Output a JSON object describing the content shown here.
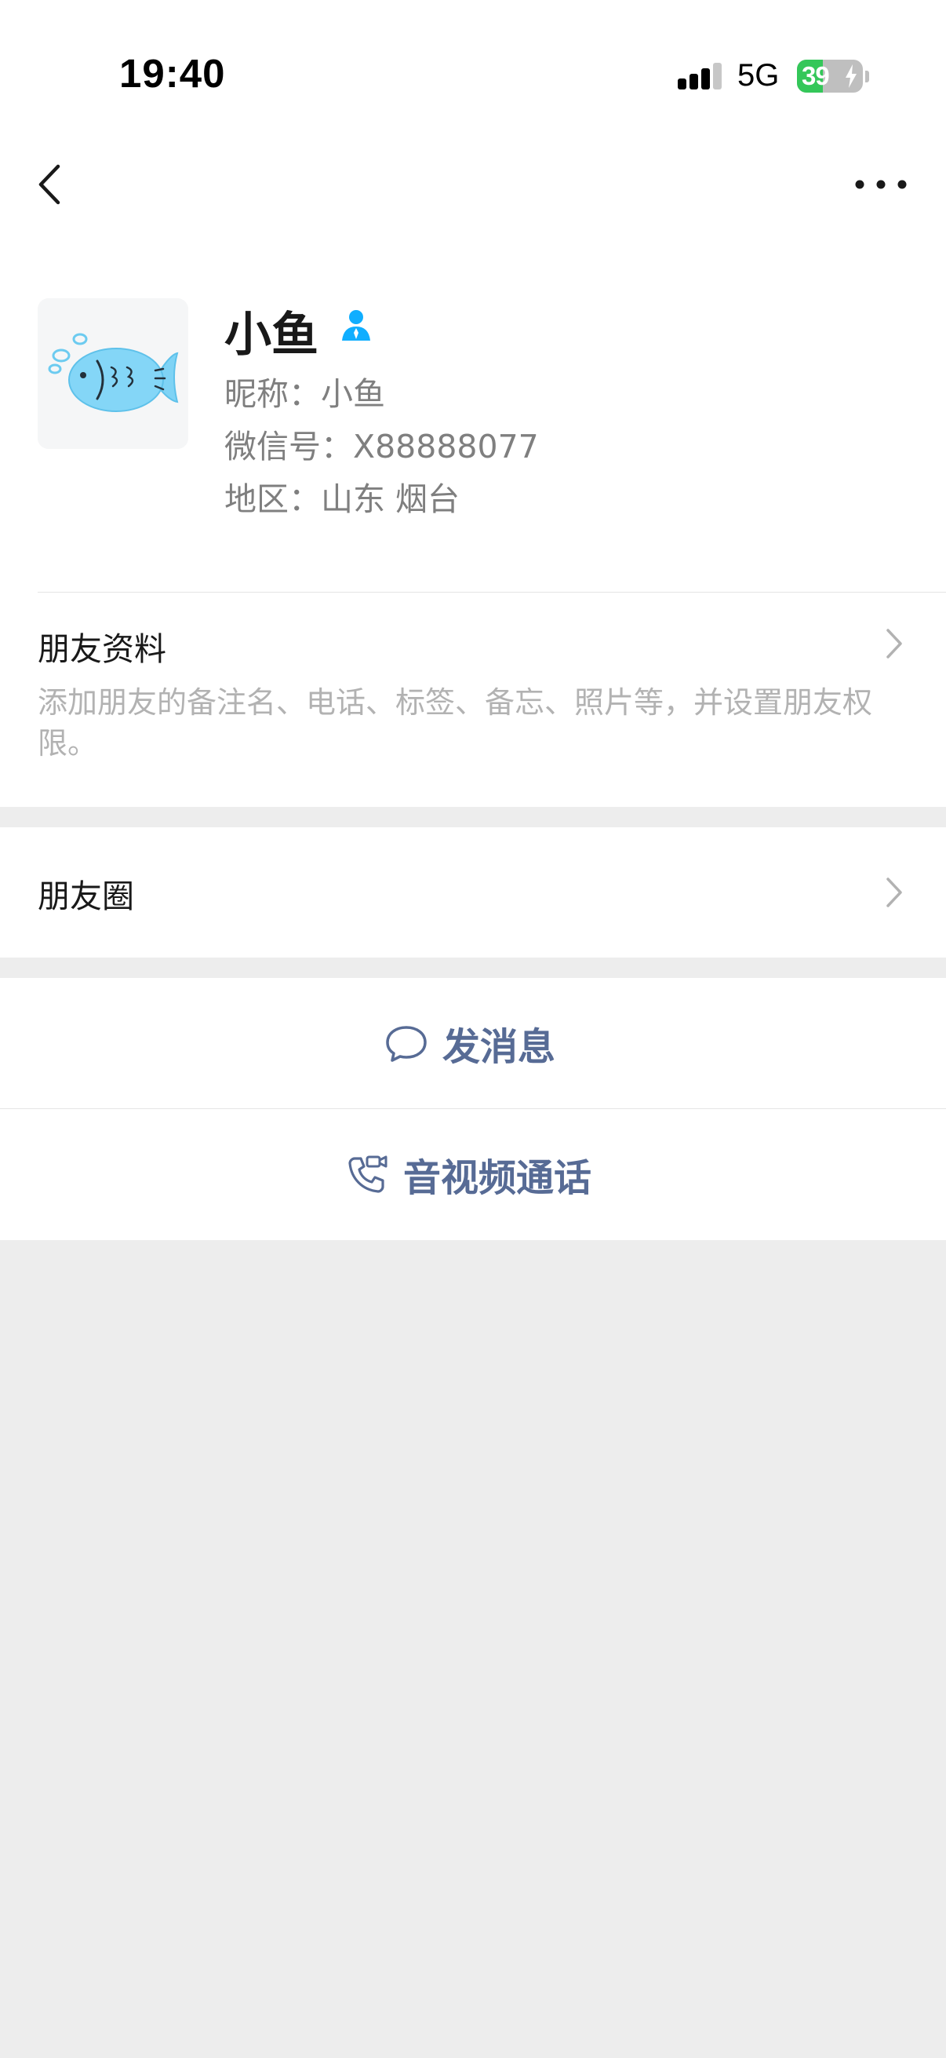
{
  "status_bar": {
    "time": "19:40",
    "network": "5G",
    "battery_percent": "39",
    "battery_level": 0.39,
    "charging": true,
    "signal_icon": "cellular-signal-icon"
  },
  "nav": {
    "back_icon": "chevron-left-icon",
    "more_icon": "more-horizontal-icon"
  },
  "profile": {
    "name": "小鱼",
    "badge_icon": "contact-person-icon",
    "avatar_icon": "fish-avatar-icon",
    "nickname_line": "昵称：小鱼",
    "wechat_id_line": "微信号：X88888077",
    "region_line": "地区：山东 烟台"
  },
  "friend_info": {
    "title": "朋友资料",
    "description": "添加朋友的备注名、电话、标签、备忘、照片等，并设置朋友权限。"
  },
  "moments": {
    "title": "朋友圈"
  },
  "actions": {
    "message_label": "发消息",
    "message_icon": "chat-bubble-icon",
    "call_label": "音视频通话",
    "call_icon": "phone-video-icon"
  },
  "colors": {
    "accent_link": "#576b95",
    "badge_blue": "#10aeff",
    "battery_green": "#34c759",
    "page_background": "#ededed"
  }
}
